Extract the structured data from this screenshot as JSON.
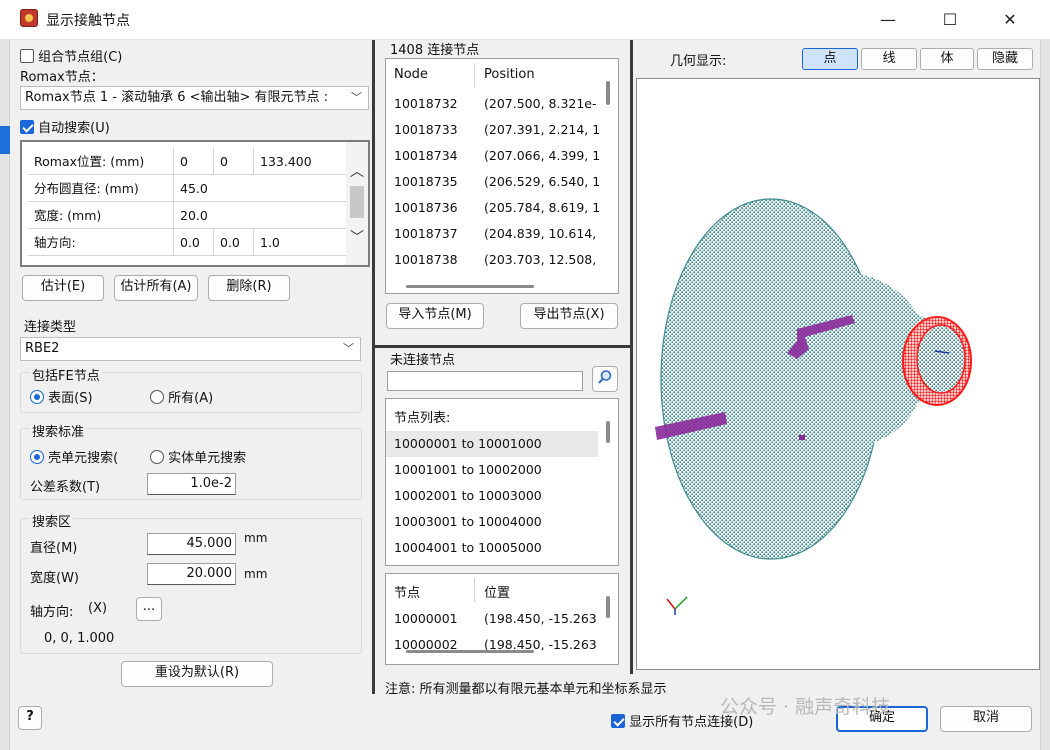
{
  "window": {
    "title": "显示接触节点",
    "minimize": "—",
    "maximize": "☐",
    "close": "✕"
  },
  "left": {
    "combine_group_label": "组合节点组(C)",
    "romax_node_label": "Romax节点：",
    "romax_node_value": "Romax节点 1 - 滚动轴承 6 <输出轴> 有限元节点 :",
    "auto_search_label": "自动搜索(U)",
    "grid": [
      {
        "name": "Romax位置: (mm)",
        "v1": "0",
        "v2": "0",
        "v3": "133.400"
      },
      {
        "name": "分布圆直径: (mm)",
        "v1": "45.0",
        "v2": "",
        "v3": ""
      },
      {
        "name": "宽度: (mm)",
        "v1": "20.0",
        "v2": "",
        "v3": ""
      },
      {
        "name": "轴方向:",
        "v1": "0.0",
        "v2": "0.0",
        "v3": "1.0"
      }
    ],
    "btn_estimate": "估计(E)",
    "btn_estimate_all": "估计所有(A)",
    "btn_delete": "删除(R)",
    "connection_type_label": "连接类型",
    "connection_type_value": "RBE2",
    "include_fe_title": "包括FE节点",
    "radio_surface": "表面(S)",
    "radio_all": "所有(A)",
    "search_criteria_title": "搜索标准",
    "radio_shell": "壳单元搜索(",
    "radio_solid": "实体单元搜索",
    "tolerance_label": "公差系数(T)",
    "tolerance_value": "1.0e-2",
    "search_zone_title": "搜索区",
    "diameter_label": "直径(M)",
    "diameter_value": "45.000",
    "width_label": "宽度(W)",
    "width_value": "20.000",
    "unit_mm": "mm",
    "axis_label": "轴方向:",
    "axis_x": "(X)",
    "axis_button": "...",
    "axis_value": "0, 0, 1.000",
    "reset_button": "重设为默认(R)"
  },
  "middle": {
    "connected_title": "1408 连接节点",
    "col_node": "Node",
    "col_position": "Position",
    "connected_rows": [
      {
        "node": "10018732",
        "pos": "(207.500, 8.321e-"
      },
      {
        "node": "10018733",
        "pos": "(207.391, 2.214, 1"
      },
      {
        "node": "10018734",
        "pos": "(207.066, 4.399, 1"
      },
      {
        "node": "10018735",
        "pos": "(206.529, 6.540, 1"
      },
      {
        "node": "10018736",
        "pos": "(205.784, 8.619, 1"
      },
      {
        "node": "10018737",
        "pos": "(204.839, 10.614,"
      },
      {
        "node": "10018738",
        "pos": "(203.703, 12.508,"
      }
    ],
    "import_button": "导入节点(M)",
    "export_button": "导出节点(X)",
    "unconnected_title": "未连接节点",
    "search_placeholder": "",
    "node_list_header": "节点列表:",
    "node_ranges": [
      "10000001 to 10001000",
      "10001001 to 10002000",
      "10002001 to 10003000",
      "10003001 to 10004000",
      "10004001 to 10005000"
    ],
    "col_node_cn": "节点",
    "col_pos_cn": "位置",
    "unconnected_rows": [
      {
        "node": "10000001",
        "pos": "(198.450, -15.263"
      },
      {
        "node": "10000002",
        "pos": "(198.450, -15.263"
      }
    ]
  },
  "right": {
    "geometry_label": "几何显示:",
    "modes": [
      "点",
      "线",
      "体",
      "隐藏"
    ],
    "active_mode": "点"
  },
  "footer": {
    "note": "注意: 所有测量都以有限元基本单元和坐标系显示",
    "show_all_label": "显示所有节点连接(D)",
    "ok_button": "确定",
    "cancel_button": "取消",
    "help_button": "?",
    "watermark": "公众号 · 融声奇科技"
  },
  "colors": {
    "accent": "#1a66d6",
    "mesh": "#3d8a8f",
    "contact_ring": "#ff1a1a",
    "contact_patch": "#8b2a9b"
  }
}
